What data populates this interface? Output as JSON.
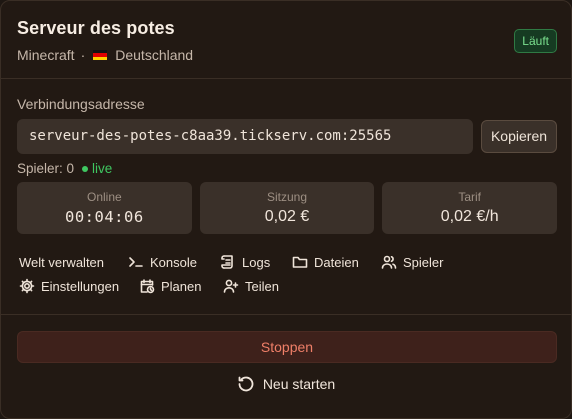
{
  "server": {
    "title": "Serveur des potes",
    "game": "Minecraft",
    "separator": "·",
    "region": "Deutschland",
    "flag_icon": "germany-flag-icon",
    "status": "Läuft"
  },
  "connection": {
    "label": "Verbindungsadresse",
    "address": "serveur-des-potes-c8aa39.tickserv.com:25565",
    "copy_label": "Kopieren"
  },
  "players": {
    "text": "Spieler: 0",
    "live_label": "live"
  },
  "stats": [
    {
      "label": "Online",
      "value": "00:04:06"
    },
    {
      "label": "Sitzung",
      "value": "0,02 €"
    },
    {
      "label": "Tarif",
      "value": "0,02 €/h"
    }
  ],
  "actions": {
    "manage_world": "Welt verwalten",
    "console": "Konsole",
    "console_icon": "terminal-icon",
    "logs": "Logs",
    "logs_icon": "scroll-icon",
    "files": "Dateien",
    "files_icon": "folder-icon",
    "players": "Spieler",
    "players_icon": "users-icon",
    "settings": "Einstellungen",
    "settings_icon": "gear-icon",
    "schedule": "Planen",
    "schedule_icon": "calendar-clock-icon",
    "share": "Teilen",
    "share_icon": "user-plus-icon"
  },
  "controls": {
    "stop": "Stoppen",
    "restart": "Neu starten",
    "restart_icon": "rotate-ccw-icon"
  },
  "colors": {
    "background": "#221913",
    "accent_green": "#3fc761",
    "stop_red": "#ef7f68"
  }
}
